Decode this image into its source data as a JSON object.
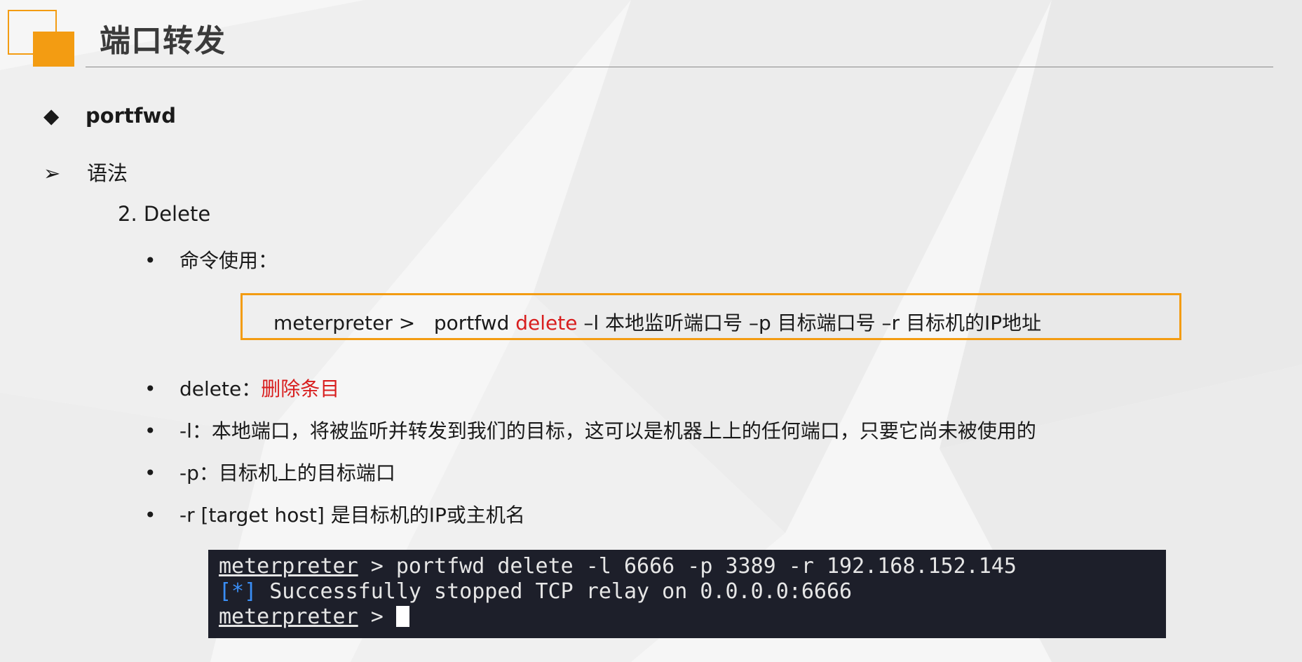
{
  "slide": {
    "title": "端口转发"
  },
  "section": {
    "marker": "◆",
    "label": "portfwd"
  },
  "subsection": {
    "marker": "➢",
    "label": "语法"
  },
  "item": {
    "label": "2.  Delete"
  },
  "usage": {
    "label": "命令使用："
  },
  "command": {
    "prompt": "meterpreter >",
    "cmd": "portfwd",
    "action": "delete",
    "args": "–l 本地监听端口号 –p 目标端口号 –r 目标机的IP地址"
  },
  "bullets": {
    "marker": "•",
    "delete_key": "delete：",
    "delete_desc": "删除条目",
    "l_text": "-l：本地端口，将被监听并转发到我们的目标，这可以是机器上上的任何端口，只要它尚未被使用的",
    "p_text": "-p：目标机上的目标端口",
    "r_text": "-r [target host] 是目标机的IP或主机名"
  },
  "terminal": {
    "prompt": "meterpreter",
    "line1_cmd": " > portfwd delete -l 6666 -p 3389 -r 192.168.152.145",
    "line2_tag": "[*]",
    "line2_msg": " Successfully stopped TCP relay on 0.0.0.0:6666",
    "line3_arrow": " > "
  },
  "colors": {
    "accent": "#f39c12",
    "highlight": "#d81e1e",
    "terminal_bg": "#1d1f2a",
    "terminal_info": "#3a8ef6"
  }
}
